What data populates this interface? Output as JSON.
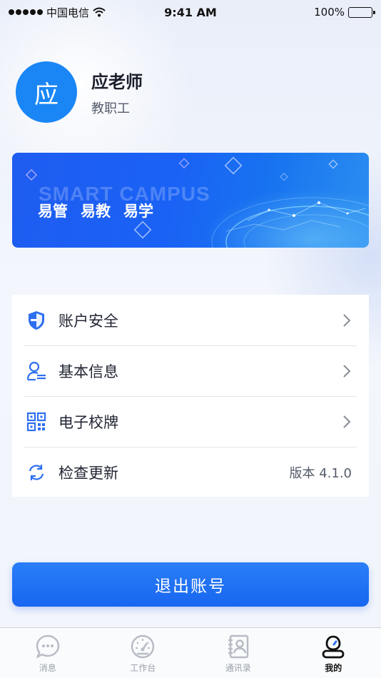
{
  "status_bar": {
    "carrier": "中国电信",
    "time": "9:41 AM",
    "battery": "100%"
  },
  "profile": {
    "avatar_char": "应",
    "name": "应老师",
    "role": "教职工"
  },
  "banner": {
    "en_text": "SMART CAMPUS",
    "slogans": [
      "易管",
      "易教",
      "易学"
    ]
  },
  "menu": {
    "items": [
      {
        "label": "账户安全",
        "icon": "shield-icon"
      },
      {
        "label": "基本信息",
        "icon": "user-info-icon"
      },
      {
        "label": "电子校牌",
        "icon": "qr-code-icon"
      },
      {
        "label": "检查更新",
        "icon": "refresh-icon",
        "value": "版本 4.1.0"
      }
    ]
  },
  "logout": {
    "label": "退出账号"
  },
  "tabbar": {
    "tabs": [
      {
        "label": "消息",
        "icon": "chat-bubble-icon"
      },
      {
        "label": "工作台",
        "icon": "dashboard-gauge-icon"
      },
      {
        "label": "通讯录",
        "icon": "contacts-book-icon"
      },
      {
        "label": "我的",
        "icon": "profile-person-icon",
        "active": true
      }
    ]
  },
  "colors": {
    "accent": "#1a86f5",
    "button": "#1f6ff2",
    "icon_blue": "#2d6ff0"
  }
}
